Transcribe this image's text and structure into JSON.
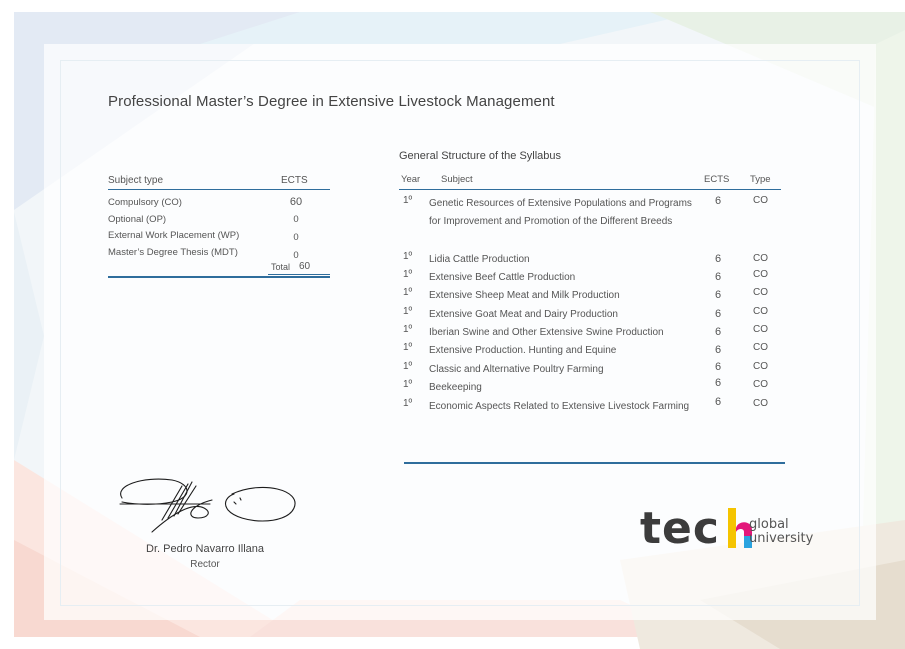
{
  "document": {
    "title": "Professional Master’s Degree in Extensive Livestock Management"
  },
  "summary_table": {
    "header_subject_type": "Subject type",
    "header_ects": "ECTS",
    "rows": [
      {
        "label": "Compulsory (CO)",
        "ects": "60"
      },
      {
        "label": "Optional (OP)",
        "ects": "0"
      },
      {
        "label": "External Work Placement (WP)",
        "ects": "0"
      },
      {
        "label": "Master’s Degree Thesis (MDT)",
        "ects": "0"
      }
    ],
    "total_label": "Total",
    "total_value": "60"
  },
  "syllabus": {
    "title": "General Structure of the Syllabus",
    "header_year": "Year",
    "header_subject": "Subject",
    "header_ects": "ECTS",
    "header_type": "Type",
    "rows": [
      {
        "year": "1º",
        "subject": "Genetic Resources of Extensive Populations and Programs for Improvement and Promotion of the Different Breeds",
        "ects": "6",
        "type": "CO"
      },
      {
        "year": "1º",
        "subject": "Lidia Cattle Production",
        "ects": "6",
        "type": "CO"
      },
      {
        "year": "1º",
        "subject": "Extensive Beef Cattle Production",
        "ects": "6",
        "type": "CO"
      },
      {
        "year": "1º",
        "subject": "Extensive Sheep Meat and Milk Production",
        "ects": "6",
        "type": "CO"
      },
      {
        "year": "1º",
        "subject": "Extensive Goat Meat and Dairy Production",
        "ects": "6",
        "type": "CO"
      },
      {
        "year": "1º",
        "subject": "Iberian Swine and Other Extensive Swine Production",
        "ects": "6",
        "type": "CO"
      },
      {
        "year": "1º",
        "subject": "Extensive Production. Hunting and Equine",
        "ects": "6",
        "type": "CO"
      },
      {
        "year": "1º",
        "subject": "Classic and Alternative Poultry Farming",
        "ects": "6",
        "type": "CO"
      },
      {
        "year": "1º",
        "subject": "Beekeeping",
        "ects": "6",
        "type": "CO"
      },
      {
        "year": "1º",
        "subject": "Economic Aspects Related to Extensive Livestock Farming",
        "ects": "6",
        "type": "CO"
      }
    ]
  },
  "signatory": {
    "name": "Dr. Pedro Navarro Illana",
    "role": "Rector",
    "signature_icon": "handwritten-signature"
  },
  "logo": {
    "word": "tec",
    "line1": "global",
    "line2": "university",
    "colors": [
      "#f5c400",
      "#e3177a",
      "#2aa3df",
      "#3c3c3c"
    ]
  },
  "colors": {
    "accent": "#2f6d9c",
    "text": "#444444"
  }
}
